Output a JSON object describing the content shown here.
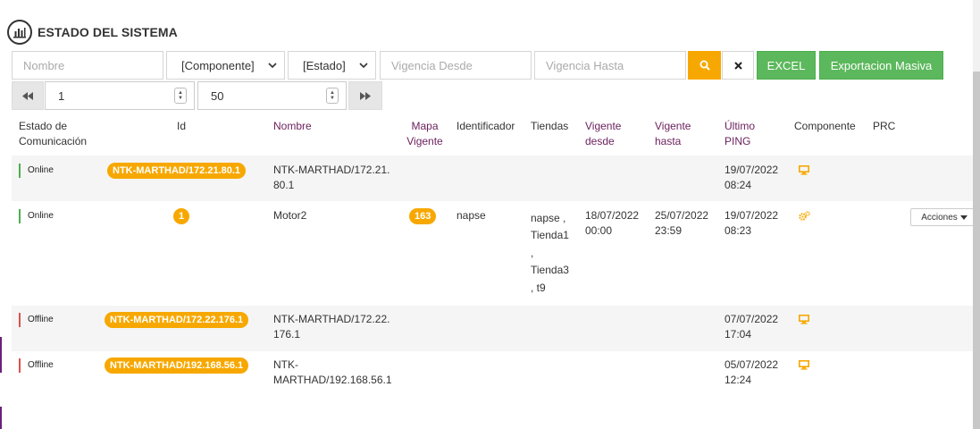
{
  "title": "ESTADO DEL SISTEMA",
  "filters": {
    "nombre_placeholder": "Nombre",
    "componente": "[Componente]",
    "estado": "[Estado]",
    "vigencia_desde_placeholder": "Vigencia Desde",
    "vigencia_hasta_placeholder": "Vigencia Hasta",
    "excel": "EXCEL",
    "exportacion": "Exportacion Masiva"
  },
  "pager": {
    "page": "1",
    "page_size": "50"
  },
  "columns": {
    "estado": "Estado de Comunicación",
    "id": "Id",
    "nombre": "Nombre",
    "mapa": "Mapa Vigente",
    "identificador": "Identificador",
    "tiendas": "Tiendas",
    "vigente_desde": "Vigente desde",
    "vigente_hasta": "Vigente hasta",
    "ultimo_ping": "Último PING",
    "componente": "Componente",
    "prc": "PRC"
  },
  "rows": [
    {
      "status": "Online",
      "id": "NTK-MARTHAD/172.21.80.1",
      "nombre_1": "NTK-MARTHAD/172.21.",
      "nombre_2": "80.1",
      "ping_1": "19/07/2022",
      "ping_2": "08:24",
      "componente_icon": "monitor-icon"
    },
    {
      "status": "Online",
      "id": "1",
      "nombre_1": "Motor2",
      "mapa": "163",
      "identificador": "napse",
      "tiendas_1": "napse ,",
      "tiendas_2": "Tienda1",
      "tiendas_3": ",",
      "tiendas_4": "Tienda3",
      "tiendas_5": ", t9",
      "desde_1": "18/07/2022",
      "desde_2": "00:00",
      "hasta_1": "25/07/2022",
      "hasta_2": "23:59",
      "ping_1": "19/07/2022",
      "ping_2": "08:23",
      "componente_icon": "gears-icon",
      "acciones": "Acciones"
    },
    {
      "status": "Offline",
      "id": "NTK-MARTHAD/172.22.176.1",
      "nombre_1": "NTK-MARTHAD/172.22.",
      "nombre_2": "176.1",
      "ping_1": "07/07/2022",
      "ping_2": "17:04",
      "componente_icon": "monitor-icon"
    },
    {
      "status": "Offline",
      "id": "NTK-MARTHAD/192.168.56.1",
      "nombre_1": "NTK-",
      "nombre_2": "MARTHAD/192.168.56.1",
      "ping_1": "05/07/2022",
      "ping_2": "12:24",
      "componente_icon": "monitor-icon"
    }
  ],
  "colors": {
    "accent": "#f7a800",
    "green": "#5cb85c",
    "online": "#4caf50",
    "offline": "#d9534f"
  }
}
